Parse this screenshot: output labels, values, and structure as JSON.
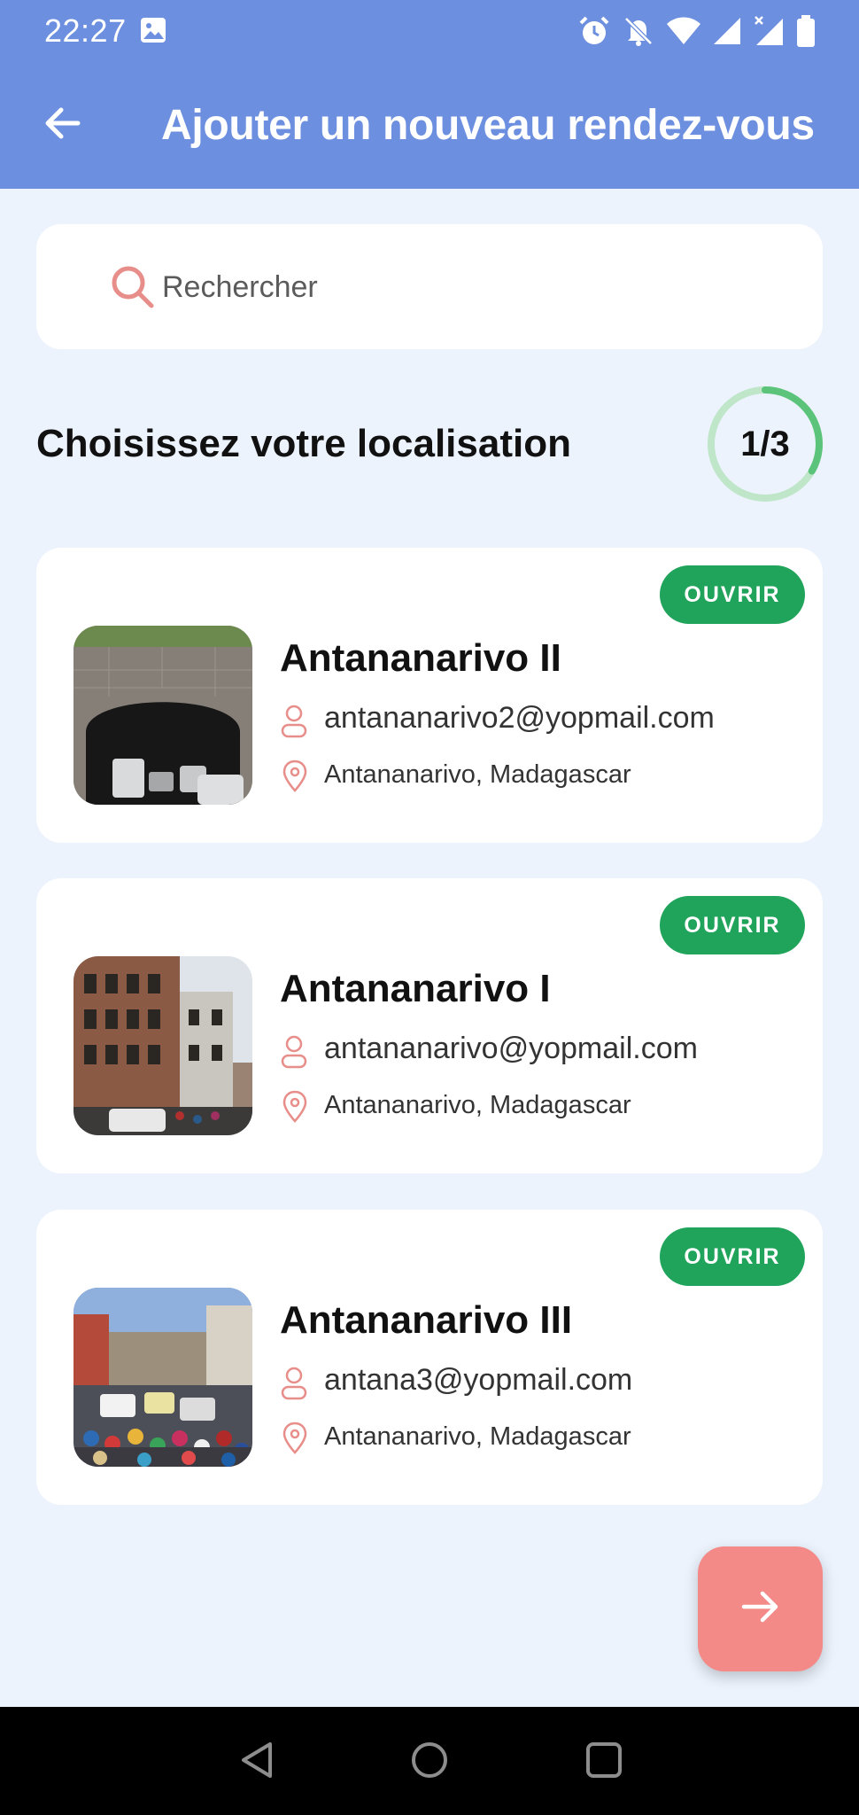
{
  "status_bar": {
    "time": "22:27",
    "icons": [
      "image-icon",
      "alarm-icon",
      "bell-off-icon",
      "wifi-icon",
      "signal-icon",
      "signal-x-icon",
      "battery-icon"
    ]
  },
  "app_bar": {
    "title": "Ajouter un nouveau rendez-vous",
    "back_icon": "arrow-left-icon"
  },
  "search": {
    "placeholder": "Rechercher",
    "value": ""
  },
  "section": {
    "title": "Choisissez votre localisation",
    "step_text": "1/3",
    "step_current": 1,
    "step_total": 3
  },
  "locations": [
    {
      "name": "Antananarivo II",
      "email": "antananarivo2@yopmail.com",
      "address": "Antananarivo, Madagascar",
      "status": "OUVRIR"
    },
    {
      "name": "Antananarivo I",
      "email": "antananarivo@yopmail.com",
      "address": "Antananarivo, Madagascar",
      "status": "OUVRIR"
    },
    {
      "name": "Antananarivo III",
      "email": "antana3@yopmail.com",
      "address": "Antananarivo, Madagascar",
      "status": "OUVRIR"
    }
  ],
  "fab": {
    "icon": "arrow-right-icon"
  },
  "nav_bar": {
    "icons": [
      "nav-back-icon",
      "nav-home-icon",
      "nav-recents-icon"
    ]
  },
  "colors": {
    "primary": "#6d8fe0",
    "background": "#edf3fd",
    "badge": "#20a35a",
    "accent": "#f38a87",
    "progress": "#5cc47a"
  }
}
